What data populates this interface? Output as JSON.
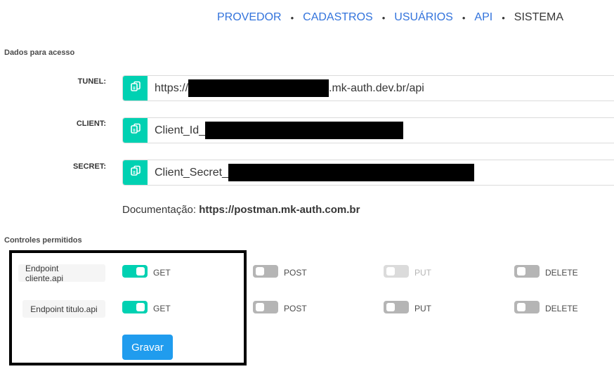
{
  "nav": {
    "items": [
      {
        "label": "PROVEDOR"
      },
      {
        "label": "CADASTROS"
      },
      {
        "label": "USUÁRIOS"
      },
      {
        "label": "API"
      },
      {
        "label": "SISTEMA"
      }
    ],
    "separator": "•",
    "link_color": "#3273dc"
  },
  "access": {
    "title": "Dados para acesso",
    "tunel": {
      "label": "TUNEL:",
      "prefix": "https://",
      "suffix": ".mk-auth.dev.br/api",
      "copy_icon": "copy-icon"
    },
    "client": {
      "label": "CLIENT:",
      "prefix": "Client_Id_",
      "copy_icon": "copy-icon"
    },
    "secret": {
      "label": "SECRET:",
      "prefix": "Client_Secret_",
      "copy_icon": "copy-icon"
    },
    "doc_label": "Documentação:",
    "doc_link": "https://postman.mk-auth.com.br"
  },
  "controls": {
    "title": "Controles permitidos",
    "endpoints": [
      {
        "name": "Endpoint cliente.api",
        "get": "GET",
        "post": "POST",
        "put": "PUT",
        "delete": "DELETE"
      },
      {
        "name": "Endpoint titulo.api",
        "get": "GET",
        "post": "POST",
        "put": "PUT",
        "delete": "DELETE"
      }
    ],
    "save_label": "Gravar"
  },
  "colors": {
    "accent": "#00d1b2",
    "save_button": "#209cee",
    "toggle_off": "#b5b5b5",
    "toggle_disabled": "#dbdbdb"
  }
}
